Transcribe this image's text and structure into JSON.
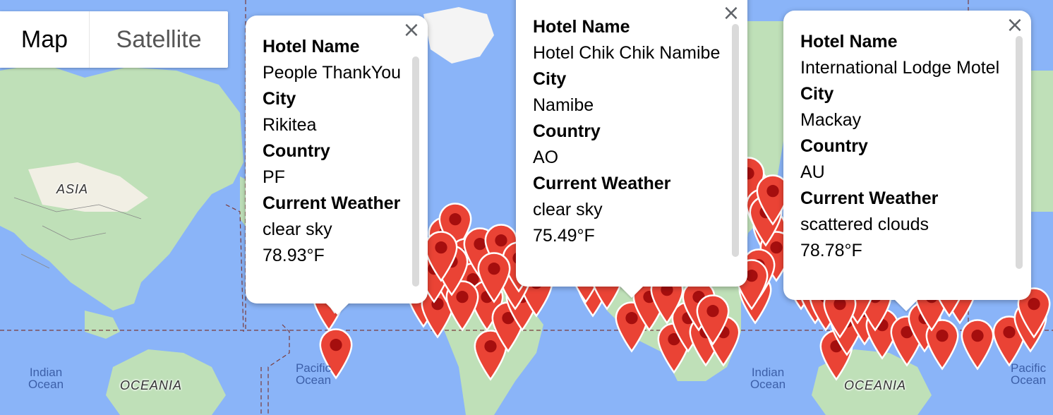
{
  "map_type_control": {
    "map_label": "Map",
    "satellite_label": "Satellite",
    "selected": "Map"
  },
  "labels": {
    "asia": "ASIA",
    "oceania_left": "OCEANIA",
    "oceania_right": "OCEANIA",
    "indian_ocean_left": "Indian Ocean",
    "pacific_ocean_mid": "Pacific Ocean",
    "indian_ocean_right": "Indian Ocean",
    "pacific_ocean_right": "Pacific Ocean"
  },
  "colors": {
    "water": "#8ab4f8",
    "land": "#bfe0b8",
    "land_dark": "#a5cf9c",
    "desert": "#f1efe4",
    "marker": "#ea4335",
    "marker_dot": "#a50e0e",
    "boundary": "#7a3b3b"
  },
  "info_windows": [
    {
      "hotel_label": "Hotel Name",
      "hotel": "People ThankYou",
      "city_label": "City",
      "city": "Rikitea",
      "country_label": "Country",
      "country": "PF",
      "weather_label": "Current Weather",
      "weather": "clear sky",
      "temp": "78.93°F"
    },
    {
      "hotel_label": "Hotel Name",
      "hotel": "Hotel Chik Chik Namibe",
      "city_label": "City",
      "city": "Namibe",
      "country_label": "Country",
      "country": "AO",
      "weather_label": "Current Weather",
      "weather": "clear sky",
      "temp": "75.49°F"
    },
    {
      "hotel_label": "Hotel Name",
      "hotel": "International Lodge Motel",
      "city_label": "City",
      "city": "Mackay",
      "country_label": "Country",
      "country": "AU",
      "weather_label": "Current Weather",
      "weather": "scattered clouds",
      "temp": "78.78°F"
    }
  ],
  "close_icon": "close-icon",
  "marker_icon": "map-pin-icon"
}
